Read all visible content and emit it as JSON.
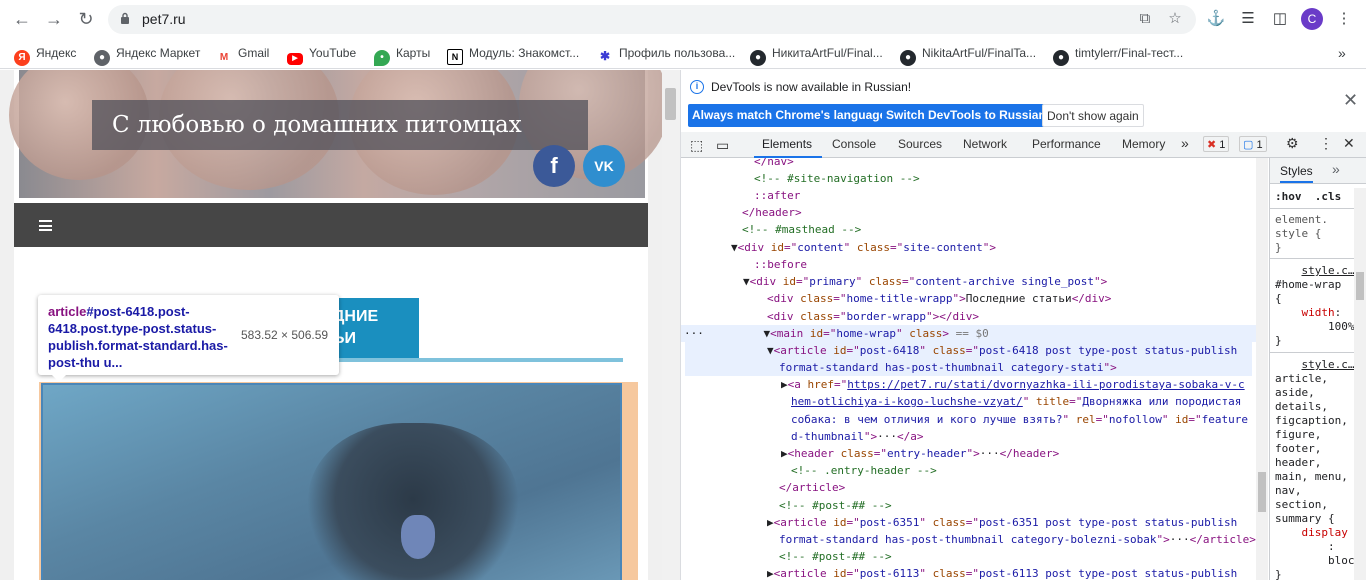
{
  "browser": {
    "url": "pet7.ru",
    "avatar_letter": "C",
    "bookmarks": [
      {
        "label": "Яндекс",
        "icon": "yandex-icon",
        "color": "#fc3f1d"
      },
      {
        "label": "Яндекс Маркет",
        "icon": "globe-icon",
        "color": "#5f6368"
      },
      {
        "label": "Gmail",
        "icon": "gmail-icon",
        "color": "#ea4335"
      },
      {
        "label": "YouTube",
        "icon": "youtube-icon",
        "color": "#ff0000"
      },
      {
        "label": "Карты",
        "icon": "maps-icon",
        "color": "#34a853"
      },
      {
        "label": "Модуль: Знакомст...",
        "icon": "notion-icon",
        "color": "#000000"
      },
      {
        "label": "Профиль пользова...",
        "icon": "profile-icon",
        "color": "#3b3bd4"
      },
      {
        "label": "НикитаArtFul/Final...",
        "icon": "github-icon",
        "color": "#24292e"
      },
      {
        "label": "NikitaArtFul/FinalTa...",
        "icon": "github-icon",
        "color": "#24292e"
      },
      {
        "label": "timtylerr/Final-тест...",
        "icon": "github-icon",
        "color": "#24292e"
      }
    ]
  },
  "site": {
    "tagline": "С любовью о домашних питомцах",
    "home_title_line1": "ДНИЕ",
    "home_title_line2": "ЬИ",
    "tooltip": {
      "tag": "article",
      "selector": "#post-6418.post-6418.post.type-post.status-publish.format-standard.has-post-thu u...",
      "size": "583.52 × 506.59"
    }
  },
  "devtools": {
    "infobar": {
      "message": "DevTools is now available in Russian!",
      "btn_match": "Always match Chrome's language",
      "btn_switch": "Switch DevTools to Russian",
      "btn_dismiss": "Don't show again"
    },
    "tabs": [
      "Elements",
      "Console",
      "Sources",
      "Network",
      "Performance",
      "Memory"
    ],
    "errors": "1",
    "messages": "1",
    "styles_tab": "Styles",
    "filter_hov": ":hov",
    "filter_cls": ".cls"
  },
  "colors": {
    "accent": "#1a73e8",
    "site_title_bg": "#1a8fbf"
  }
}
